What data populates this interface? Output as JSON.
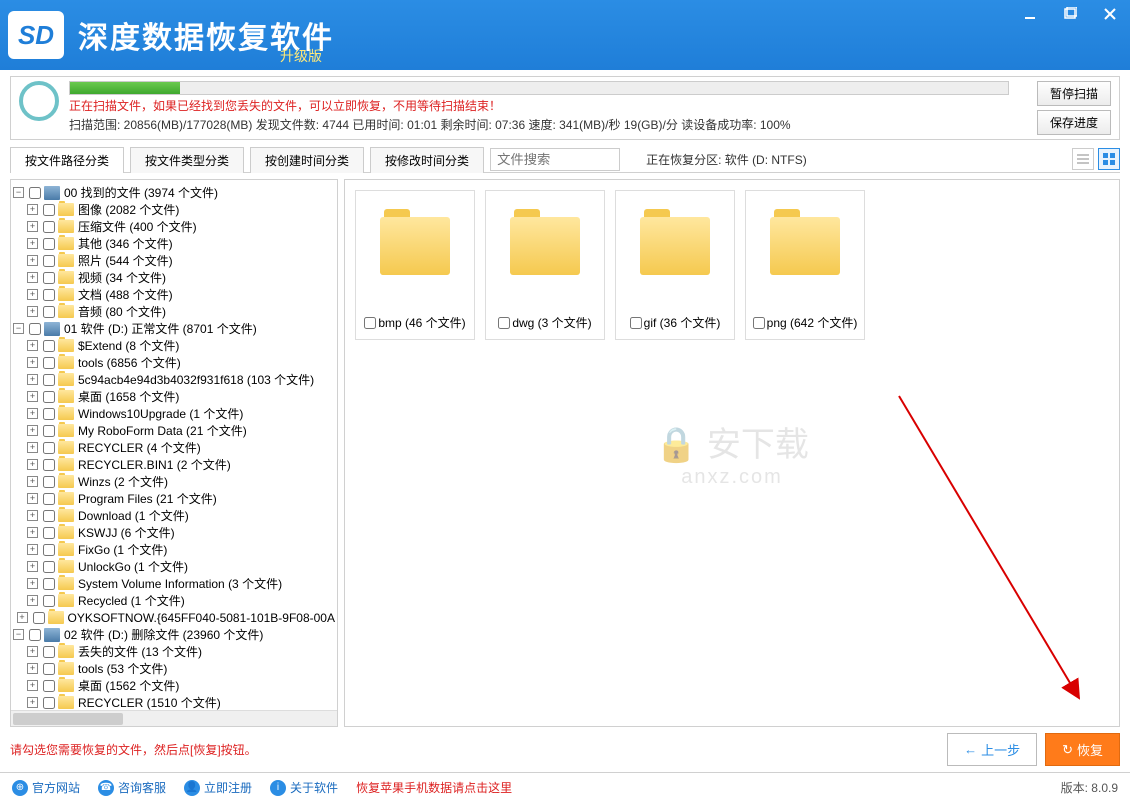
{
  "titlebar": {
    "logo": "SD",
    "title": "深度数据恢复软件",
    "subtitle": "升级版"
  },
  "scan": {
    "message": "正在扫描文件，如果已经找到您丢失的文件，可以立即恢复，不用等待扫描结束！",
    "stats": "扫描范围: 20856(MB)/177028(MB)   发现文件数: 4744   已用时间: 01:01   剩余时间: 07:36   速度: 341(MB)/秒  19(GB)/分  读设备成功率: 100%",
    "pause": "暂停扫描",
    "save": "保存进度"
  },
  "tabs": {
    "t0": "按文件路径分类",
    "t1": "按文件类型分类",
    "t2": "按创建时间分类",
    "t3": "按修改时间分类",
    "search_ph": "文件搜索",
    "partition": "正在恢复分区: 软件 (D: NTFS)"
  },
  "tree": {
    "g0": "00 找到的文件  (3974 个文件)",
    "g0_c0": "图像     (2082 个文件)",
    "g0_c1": "压缩文件    (400 个文件)",
    "g0_c2": "其他    (346 个文件)",
    "g0_c3": "照片    (544 个文件)",
    "g0_c4": "视频    (34 个文件)",
    "g0_c5": "文档    (488 个文件)",
    "g0_c6": "音频    (80 个文件)",
    "g1": "01 软件 (D:) 正常文件 (8701 个文件)",
    "g1_c0": "$Extend    (8 个文件)",
    "g1_c1": "tools    (6856 个文件)",
    "g1_c2": "5c94acb4e94d3b4032f931f618    (103 个文件)",
    "g1_c3": "桌面    (1658 个文件)",
    "g1_c4": "Windows10Upgrade    (1 个文件)",
    "g1_c5": "My RoboForm Data    (21 个文件)",
    "g1_c6": "RECYCLER    (4 个文件)",
    "g1_c7": "RECYCLER.BIN1    (2 个文件)",
    "g1_c8": "Winzs    (2 个文件)",
    "g1_c9": "Program Files    (21 个文件)",
    "g1_c10": "Download    (1 个文件)",
    "g1_c11": "KSWJJ    (6 个文件)",
    "g1_c12": "FixGo    (1 个文件)",
    "g1_c13": "UnlockGo    (1 个文件)",
    "g1_c14": "System Volume Information    (3 个文件)",
    "g1_c15": "Recycled    (1 个文件)",
    "g1_c16": "OYKSOFTNOW.{645FF040-5081-101B-9F08-00A",
    "g2": "02 软件 (D:) 删除文件 (23960 个文件)",
    "g2_c0": "丢失的文件    (13 个文件)",
    "g2_c1": "tools    (53 个文件)",
    "g2_c2": "桌面    (1562 个文件)",
    "g2_c3": "RECYCLER    (1510 个文件)"
  },
  "thumbs": {
    "t0": "bmp  (46 个文件)",
    "t1": "dwg  (3 个文件)",
    "t2": "gif  (36 个文件)",
    "t3": "png  (642 个文件)"
  },
  "watermark": {
    "line1": "安下载",
    "line2": "anxz.com"
  },
  "action": {
    "hint": "请勾选您需要恢复的文件，然后点[恢复]按钮。",
    "prev": "上一步",
    "recover": "恢复"
  },
  "bottom": {
    "b0": "官方网站",
    "b1": "咨询客服",
    "b2": "立即注册",
    "b3": "关于软件",
    "apple": "恢复苹果手机数据请点击这里",
    "version": "版本: 8.0.9"
  }
}
